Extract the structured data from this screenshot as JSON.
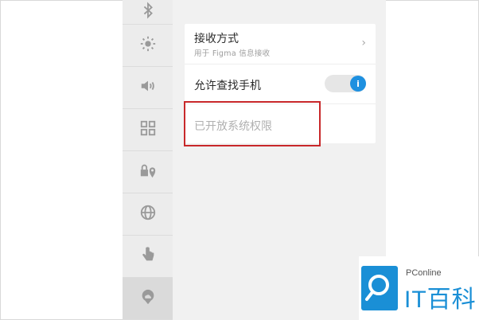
{
  "sidebar": {
    "items": [
      {
        "icon": "bluetooth-icon"
      },
      {
        "icon": "brightness-icon"
      },
      {
        "icon": "volume-icon"
      },
      {
        "icon": "grid-icon"
      },
      {
        "icon": "lock-location-icon"
      },
      {
        "icon": "globe-icon"
      },
      {
        "icon": "hand-icon"
      },
      {
        "icon": "cloud-location-icon",
        "active": true
      }
    ]
  },
  "settings": {
    "receive_method": {
      "title": "接收方式",
      "subtitle": "用于 Figma 信息接收"
    },
    "find_phone": {
      "label": "允许查找手机",
      "toggle_on": true,
      "toggle_glyph": "i"
    },
    "system_permission": {
      "label": "已开放系统权限"
    }
  },
  "colors": {
    "accent": "#1e90e0",
    "highlight": "#c8282a"
  },
  "watermark": {
    "brand_small": "PConline",
    "brand_big": "IT百科"
  }
}
